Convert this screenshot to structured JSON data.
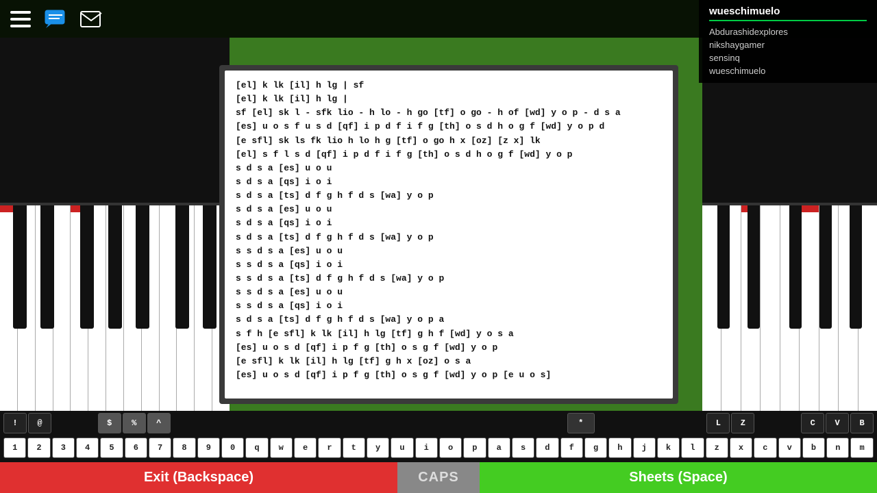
{
  "topBar": {
    "username": "wueschimuelo",
    "players": [
      "Abdurashidexplores",
      "nikshaygamer",
      "sensinq",
      "wueschimuelo"
    ]
  },
  "sheet": {
    "lines": [
      "[el] k lk [il] h lg | sf",
      "[el] k lk [il] h lg |",
      "sf [el] sk l - sfk lio - h lo - h go [tf] o go - h of [wd] y o p - d s a",
      "[es] u o s f u s d [qf] i p d f i f g [th] o s d h o g f [wd] y o p d",
      "[e sfl] sk ls fk lio h lo h g [tf] o go h x [oz] [z x] lk",
      "[el] s f l s d [qf] i p d f i f g [th] o s d h o g f [wd] y o p",
      "s d s a [es] u o u",
      "s d s a [qs] i o i",
      "s d s a [ts] d f g h f d s [wa] y o p",
      "s d s a [es] u o u",
      "s d s a [qs] i o i",
      "s d s a [ts] d f g h f d s [wa] y o p",
      "s s d s a [es] u o u",
      "s s d s a [qs] i o i",
      "s s d s a [ts] d f g h f d s [wa] y o p",
      "s s d s a [es] u o u",
      "s s d s a [qs] i o i",
      "s d s a [ts] d f g h f d s [wa] y o p a",
      "s f h [e sfl] k lk [il] h lg [tf] g h f [wd] y o s a",
      "[es] u o s d [qf] i p f g [th] o s g f [wd] y o p",
      "[e sfl] k lk [il] h lg [tf] g h x [oz] o s a",
      "[es] u o s d [qf] i p f g [th] o s g f [wd] y o p [e u o s]"
    ]
  },
  "keyboard": {
    "row1": [
      "!",
      "@",
      "$",
      "%",
      "^",
      "*",
      "L",
      "Z",
      "C",
      "V",
      "B"
    ],
    "row2": [
      "1",
      "2",
      "3",
      "4",
      "5",
      "6",
      "7",
      "8",
      "9",
      "0",
      "q",
      "w",
      "e",
      "r",
      "t",
      "y",
      "u",
      "i",
      "o",
      "p",
      "a",
      "s",
      "d",
      "f",
      "g",
      "h",
      "j",
      "k",
      "l",
      "z",
      "x",
      "c",
      "v",
      "b",
      "n",
      "m"
    ]
  },
  "buttons": {
    "exit": "Exit (Backspace)",
    "caps": "CAPS",
    "sheets": "Sheets (Space)"
  }
}
